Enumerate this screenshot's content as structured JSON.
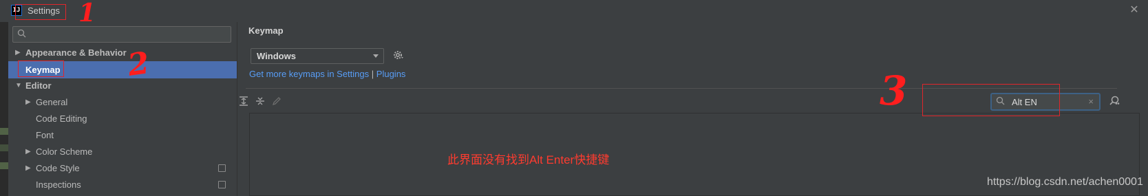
{
  "window": {
    "app_icon": "IJ",
    "title": "Settings",
    "close_glyph": "✕"
  },
  "sidebar": {
    "search_icon_glyph": "Q",
    "items": [
      {
        "label": "Appearance & Behavior",
        "expanded": false,
        "bold": true,
        "selected": false,
        "level": 0
      },
      {
        "label": "Keymap",
        "bold": true,
        "selected": true,
        "level": 0
      },
      {
        "label": "Editor",
        "expanded": true,
        "bold": true,
        "selected": false,
        "level": 0
      },
      {
        "label": "General",
        "expanded": false,
        "level": 1
      },
      {
        "label": "Code Editing",
        "level": 1
      },
      {
        "label": "Font",
        "level": 1
      },
      {
        "label": "Color Scheme",
        "expanded": false,
        "level": 1
      },
      {
        "label": "Code Style",
        "expanded": false,
        "level": 1,
        "has_side_icon": true
      },
      {
        "label": "Inspections",
        "level": 1,
        "has_side_icon": true
      }
    ]
  },
  "main": {
    "title": "Keymap",
    "keymap_selected": "Windows",
    "links": {
      "prefix": "Get more keymaps in Settings",
      "separator": "|",
      "plugins": "Plugins"
    },
    "toolbar_icons": [
      "expand-all-icon",
      "collapse-all-icon",
      "edit-icon"
    ],
    "search": {
      "value": "Alt EN",
      "clear_glyph": "×"
    }
  },
  "annotations": {
    "marks": [
      "1",
      "2",
      "3"
    ],
    "note": "此界面没有找到Alt Enter快捷键",
    "color": "#ff1e1e"
  },
  "watermark": "https://blog.csdn.net/achen0001",
  "colors": {
    "background": "#3c3f41",
    "selection": "#4b6eaf",
    "link": "#589df6",
    "annotation": "#e0262b"
  }
}
